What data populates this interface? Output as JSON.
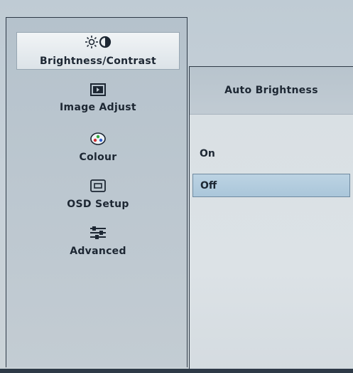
{
  "menu": {
    "items": [
      {
        "label": "Brightness/Contrast",
        "icon": "brightness-contrast-icon",
        "selected": true
      },
      {
        "label": "Image Adjust",
        "icon": "image-adjust-icon",
        "selected": false
      },
      {
        "label": "Colour",
        "icon": "colour-palette-icon",
        "selected": false
      },
      {
        "label": "OSD Setup",
        "icon": "osd-setup-icon",
        "selected": false
      },
      {
        "label": "Advanced",
        "icon": "advanced-sliders-icon",
        "selected": false
      }
    ]
  },
  "submenu": {
    "title": "Auto Brightness",
    "options": [
      {
        "label": "On",
        "selected": false
      },
      {
        "label": "Off",
        "selected": true
      }
    ]
  },
  "colors": {
    "selected_option_bg": "#aac6da",
    "menu_panel_bg": "#b5c2cc",
    "text": "#1d2733"
  }
}
